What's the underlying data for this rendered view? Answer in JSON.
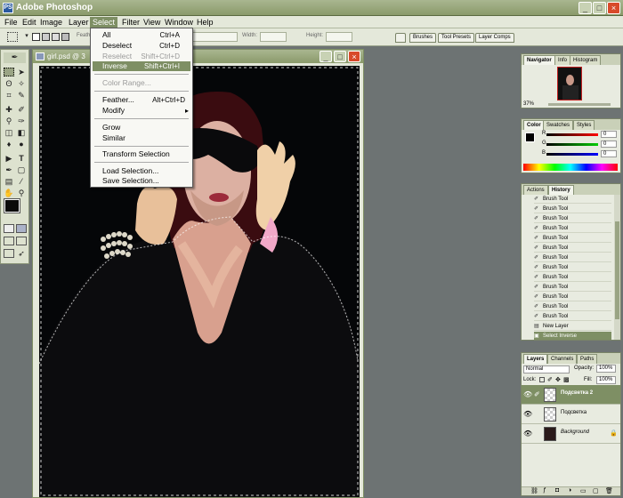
{
  "app": {
    "title": "Adobe Photoshop",
    "icon": "PS"
  },
  "window_controls": {
    "minimize": "_",
    "maximize": "□",
    "close": "×"
  },
  "menubar": [
    "File",
    "Edit",
    "Image",
    "Layer",
    "Select",
    "Filter",
    "View",
    "Window",
    "Help"
  ],
  "options_bar": {
    "feather_label": "Feath",
    "width_label": "Width:",
    "height_label": "Height:",
    "tabs": [
      "Brushes",
      "Tool Presets",
      "Layer Comps"
    ]
  },
  "document": {
    "title": "girl.psd @ 3"
  },
  "select_menu": {
    "items": [
      {
        "label": "All",
        "shortcut": "Ctrl+A",
        "disabled": false
      },
      {
        "label": "Deselect",
        "shortcut": "Ctrl+D",
        "disabled": false
      },
      {
        "label": "Reselect",
        "shortcut": "Shift+Ctrl+D",
        "disabled": true
      },
      {
        "label": "Inverse",
        "shortcut": "Shift+Ctrl+I",
        "disabled": false,
        "highlighted": true
      },
      {
        "label": "Color Range...",
        "shortcut": "",
        "disabled": true
      },
      {
        "label": "Feather...",
        "shortcut": "Alt+Ctrl+D",
        "disabled": false
      },
      {
        "label": "Modify",
        "shortcut": "▸",
        "disabled": false
      },
      {
        "label": "Grow",
        "shortcut": "",
        "disabled": false
      },
      {
        "label": "Similar",
        "shortcut": "",
        "disabled": false
      },
      {
        "label": "Transform Selection",
        "shortcut": "",
        "disabled": false
      },
      {
        "label": "Load Selection...",
        "shortcut": "",
        "disabled": false
      },
      {
        "label": "Save Selection...",
        "shortcut": "",
        "disabled": false
      }
    ]
  },
  "navigator": {
    "tabs": [
      "Navigator",
      "Info",
      "Histogram"
    ],
    "zoom": "37%"
  },
  "color": {
    "tabs": [
      "Color",
      "Swatches",
      "Styles"
    ],
    "channels": [
      {
        "label": "R",
        "value": "0"
      },
      {
        "label": "G",
        "value": "0"
      },
      {
        "label": "B",
        "value": "0"
      }
    ]
  },
  "history": {
    "tabs": [
      "Actions",
      "History"
    ],
    "rows": [
      "Brush Tool",
      "Brush Tool",
      "Brush Tool",
      "Brush Tool",
      "Brush Tool",
      "Brush Tool",
      "Brush Tool",
      "Brush Tool",
      "Brush Tool",
      "Brush Tool",
      "Brush Tool",
      "Brush Tool",
      "Brush Tool",
      "New Layer",
      "Select Inverse"
    ]
  },
  "layers": {
    "tabs": [
      "Layers",
      "Channels",
      "Paths"
    ],
    "blend_mode": "Normal",
    "opacity_label": "Opacity:",
    "opacity": "100%",
    "lock_label": "Lock:",
    "fill_label": "Fill:",
    "fill": "100%",
    "rows": [
      {
        "name": "Подсветка 2",
        "selected": true
      },
      {
        "name": "Подсветка",
        "selected": false
      },
      {
        "name": "Background",
        "selected": false
      }
    ]
  },
  "colors": {
    "accent": "#7e8f64",
    "title": "#8a9a6a",
    "workspace": "#6d7373"
  }
}
